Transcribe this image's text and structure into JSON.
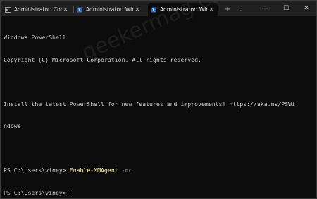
{
  "tabs": [
    {
      "label": "Administrator: Comm",
      "icon": "cmd-icon",
      "active": false
    },
    {
      "label": "Administrator: Windo",
      "icon": "powershell-icon",
      "active": false
    },
    {
      "label": "Administrator: Windo",
      "icon": "powershell-icon",
      "active": true
    }
  ],
  "tab_close_glyph": "✕",
  "new_tab_glyph": "+",
  "dropdown_glyph": "⌄",
  "window_controls": {
    "minimize": "—",
    "maximize": "☐",
    "close": "✕"
  },
  "terminal": {
    "line1": "Windows PowerShell",
    "line2": "Copyright (C) Microsoft Corporation. All rights reserved.",
    "line3": "Install the latest PowerShell for new features and improvements! https://aka.ms/PSWi",
    "line4": "ndows",
    "prompt1": "PS C:\\Users\\viney> ",
    "command": "Enable-MMAgent",
    "param": " -mc",
    "prompt2": "PS C:\\Users\\viney> "
  },
  "watermark": "geekermag.com",
  "colors": {
    "background": "#0c0c0c",
    "titlebar": "#202020",
    "text": "#cccccc",
    "command": "#f9f1a5",
    "parameter": "#8a8a8a"
  }
}
